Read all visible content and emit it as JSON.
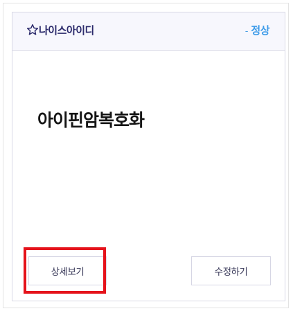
{
  "card": {
    "icon": "star-outline-icon",
    "title": "나이스아이디",
    "status_prefix": "-",
    "status": "정상",
    "main_title": "아이핀암복호화",
    "detail_button": "상세보기",
    "edit_button": "수정하기"
  },
  "colors": {
    "title": "#2b2a6b",
    "status": "#3d9be9",
    "highlight": "#e5131b",
    "header_bg": "#f7f7fd"
  }
}
